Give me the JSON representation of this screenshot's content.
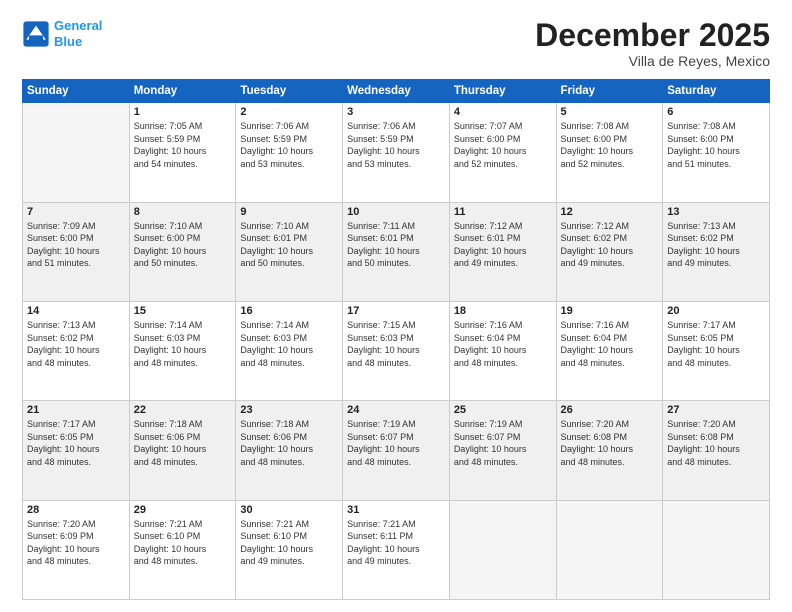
{
  "logo": {
    "line1": "General",
    "line2": "Blue"
  },
  "title": "December 2025",
  "subtitle": "Villa de Reyes, Mexico",
  "days_header": [
    "Sunday",
    "Monday",
    "Tuesday",
    "Wednesday",
    "Thursday",
    "Friday",
    "Saturday"
  ],
  "weeks": [
    [
      {
        "day": "",
        "info": ""
      },
      {
        "day": "1",
        "info": "Sunrise: 7:05 AM\nSunset: 5:59 PM\nDaylight: 10 hours\nand 54 minutes."
      },
      {
        "day": "2",
        "info": "Sunrise: 7:06 AM\nSunset: 5:59 PM\nDaylight: 10 hours\nand 53 minutes."
      },
      {
        "day": "3",
        "info": "Sunrise: 7:06 AM\nSunset: 5:59 PM\nDaylight: 10 hours\nand 53 minutes."
      },
      {
        "day": "4",
        "info": "Sunrise: 7:07 AM\nSunset: 6:00 PM\nDaylight: 10 hours\nand 52 minutes."
      },
      {
        "day": "5",
        "info": "Sunrise: 7:08 AM\nSunset: 6:00 PM\nDaylight: 10 hours\nand 52 minutes."
      },
      {
        "day": "6",
        "info": "Sunrise: 7:08 AM\nSunset: 6:00 PM\nDaylight: 10 hours\nand 51 minutes."
      }
    ],
    [
      {
        "day": "7",
        "info": "Sunrise: 7:09 AM\nSunset: 6:00 PM\nDaylight: 10 hours\nand 51 minutes."
      },
      {
        "day": "8",
        "info": "Sunrise: 7:10 AM\nSunset: 6:00 PM\nDaylight: 10 hours\nand 50 minutes."
      },
      {
        "day": "9",
        "info": "Sunrise: 7:10 AM\nSunset: 6:01 PM\nDaylight: 10 hours\nand 50 minutes."
      },
      {
        "day": "10",
        "info": "Sunrise: 7:11 AM\nSunset: 6:01 PM\nDaylight: 10 hours\nand 50 minutes."
      },
      {
        "day": "11",
        "info": "Sunrise: 7:12 AM\nSunset: 6:01 PM\nDaylight: 10 hours\nand 49 minutes."
      },
      {
        "day": "12",
        "info": "Sunrise: 7:12 AM\nSunset: 6:02 PM\nDaylight: 10 hours\nand 49 minutes."
      },
      {
        "day": "13",
        "info": "Sunrise: 7:13 AM\nSunset: 6:02 PM\nDaylight: 10 hours\nand 49 minutes."
      }
    ],
    [
      {
        "day": "14",
        "info": "Sunrise: 7:13 AM\nSunset: 6:02 PM\nDaylight: 10 hours\nand 48 minutes."
      },
      {
        "day": "15",
        "info": "Sunrise: 7:14 AM\nSunset: 6:03 PM\nDaylight: 10 hours\nand 48 minutes."
      },
      {
        "day": "16",
        "info": "Sunrise: 7:14 AM\nSunset: 6:03 PM\nDaylight: 10 hours\nand 48 minutes."
      },
      {
        "day": "17",
        "info": "Sunrise: 7:15 AM\nSunset: 6:03 PM\nDaylight: 10 hours\nand 48 minutes."
      },
      {
        "day": "18",
        "info": "Sunrise: 7:16 AM\nSunset: 6:04 PM\nDaylight: 10 hours\nand 48 minutes."
      },
      {
        "day": "19",
        "info": "Sunrise: 7:16 AM\nSunset: 6:04 PM\nDaylight: 10 hours\nand 48 minutes."
      },
      {
        "day": "20",
        "info": "Sunrise: 7:17 AM\nSunset: 6:05 PM\nDaylight: 10 hours\nand 48 minutes."
      }
    ],
    [
      {
        "day": "21",
        "info": "Sunrise: 7:17 AM\nSunset: 6:05 PM\nDaylight: 10 hours\nand 48 minutes."
      },
      {
        "day": "22",
        "info": "Sunrise: 7:18 AM\nSunset: 6:06 PM\nDaylight: 10 hours\nand 48 minutes."
      },
      {
        "day": "23",
        "info": "Sunrise: 7:18 AM\nSunset: 6:06 PM\nDaylight: 10 hours\nand 48 minutes."
      },
      {
        "day": "24",
        "info": "Sunrise: 7:19 AM\nSunset: 6:07 PM\nDaylight: 10 hours\nand 48 minutes."
      },
      {
        "day": "25",
        "info": "Sunrise: 7:19 AM\nSunset: 6:07 PM\nDaylight: 10 hours\nand 48 minutes."
      },
      {
        "day": "26",
        "info": "Sunrise: 7:20 AM\nSunset: 6:08 PM\nDaylight: 10 hours\nand 48 minutes."
      },
      {
        "day": "27",
        "info": "Sunrise: 7:20 AM\nSunset: 6:08 PM\nDaylight: 10 hours\nand 48 minutes."
      }
    ],
    [
      {
        "day": "28",
        "info": "Sunrise: 7:20 AM\nSunset: 6:09 PM\nDaylight: 10 hours\nand 48 minutes."
      },
      {
        "day": "29",
        "info": "Sunrise: 7:21 AM\nSunset: 6:10 PM\nDaylight: 10 hours\nand 48 minutes."
      },
      {
        "day": "30",
        "info": "Sunrise: 7:21 AM\nSunset: 6:10 PM\nDaylight: 10 hours\nand 49 minutes."
      },
      {
        "day": "31",
        "info": "Sunrise: 7:21 AM\nSunset: 6:11 PM\nDaylight: 10 hours\nand 49 minutes."
      },
      {
        "day": "",
        "info": ""
      },
      {
        "day": "",
        "info": ""
      },
      {
        "day": "",
        "info": ""
      }
    ]
  ]
}
